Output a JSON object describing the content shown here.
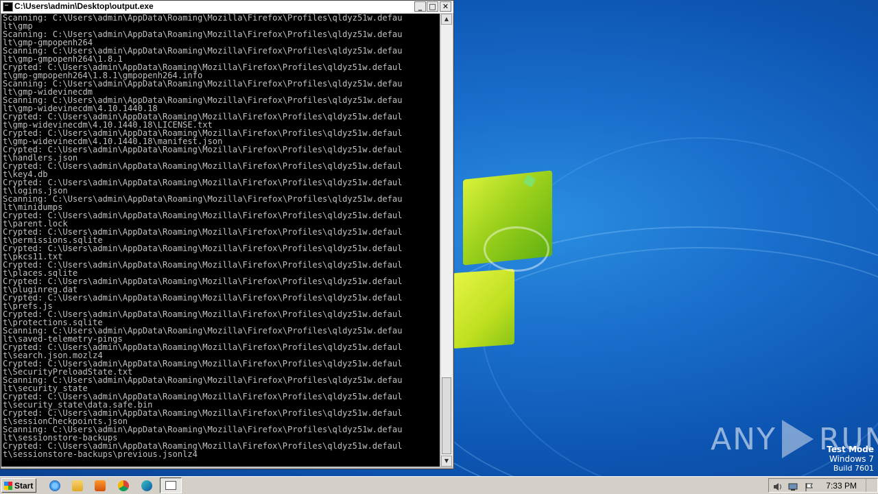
{
  "window": {
    "title": "C:\\Users\\admin\\Desktop\\output.exe",
    "buttons": {
      "minimize": "_",
      "maximize": "□",
      "close": "✕"
    },
    "console_lines": [
      "Scanning: C:\\Users\\admin\\AppData\\Roaming\\Mozilla\\Firefox\\Profiles\\qldyz51w.defau",
      "lt\\gmp",
      "Scanning: C:\\Users\\admin\\AppData\\Roaming\\Mozilla\\Firefox\\Profiles\\qldyz51w.defau",
      "lt\\gmp-gmpopenh264",
      "Scanning: C:\\Users\\admin\\AppData\\Roaming\\Mozilla\\Firefox\\Profiles\\qldyz51w.defau",
      "lt\\gmp-gmpopenh264\\1.8.1",
      "Crypted: C:\\Users\\admin\\AppData\\Roaming\\Mozilla\\Firefox\\Profiles\\qldyz51w.defaul",
      "t\\gmp-gmpopenh264\\1.8.1\\gmpopenh264.info",
      "Scanning: C:\\Users\\admin\\AppData\\Roaming\\Mozilla\\Firefox\\Profiles\\qldyz51w.defau",
      "lt\\gmp-widevinecdm",
      "Scanning: C:\\Users\\admin\\AppData\\Roaming\\Mozilla\\Firefox\\Profiles\\qldyz51w.defau",
      "lt\\gmp-widevinecdm\\4.10.1440.18",
      "Crypted: C:\\Users\\admin\\AppData\\Roaming\\Mozilla\\Firefox\\Profiles\\qldyz51w.defaul",
      "t\\gmp-widevinecdm\\4.10.1440.18\\LICENSE.txt",
      "Crypted: C:\\Users\\admin\\AppData\\Roaming\\Mozilla\\Firefox\\Profiles\\qldyz51w.defaul",
      "t\\gmp-widevinecdm\\4.10.1440.18\\manifest.json",
      "Crypted: C:\\Users\\admin\\AppData\\Roaming\\Mozilla\\Firefox\\Profiles\\qldyz51w.defaul",
      "t\\handlers.json",
      "Crypted: C:\\Users\\admin\\AppData\\Roaming\\Mozilla\\Firefox\\Profiles\\qldyz51w.defaul",
      "t\\key4.db",
      "Crypted: C:\\Users\\admin\\AppData\\Roaming\\Mozilla\\Firefox\\Profiles\\qldyz51w.defaul",
      "t\\logins.json",
      "Scanning: C:\\Users\\admin\\AppData\\Roaming\\Mozilla\\Firefox\\Profiles\\qldyz51w.defau",
      "lt\\minidumps",
      "Crypted: C:\\Users\\admin\\AppData\\Roaming\\Mozilla\\Firefox\\Profiles\\qldyz51w.defaul",
      "t\\parent.lock",
      "Crypted: C:\\Users\\admin\\AppData\\Roaming\\Mozilla\\Firefox\\Profiles\\qldyz51w.defaul",
      "t\\permissions.sqlite",
      "Crypted: C:\\Users\\admin\\AppData\\Roaming\\Mozilla\\Firefox\\Profiles\\qldyz51w.defaul",
      "t\\pkcs11.txt",
      "Crypted: C:\\Users\\admin\\AppData\\Roaming\\Mozilla\\Firefox\\Profiles\\qldyz51w.defaul",
      "t\\places.sqlite",
      "Crypted: C:\\Users\\admin\\AppData\\Roaming\\Mozilla\\Firefox\\Profiles\\qldyz51w.defaul",
      "t\\pluginreg.dat",
      "Crypted: C:\\Users\\admin\\AppData\\Roaming\\Mozilla\\Firefox\\Profiles\\qldyz51w.defaul",
      "t\\prefs.js",
      "Crypted: C:\\Users\\admin\\AppData\\Roaming\\Mozilla\\Firefox\\Profiles\\qldyz51w.defaul",
      "t\\protections.sqlite",
      "Scanning: C:\\Users\\admin\\AppData\\Roaming\\Mozilla\\Firefox\\Profiles\\qldyz51w.defau",
      "lt\\saved-telemetry-pings",
      "Crypted: C:\\Users\\admin\\AppData\\Roaming\\Mozilla\\Firefox\\Profiles\\qldyz51w.defaul",
      "t\\search.json.mozlz4",
      "Crypted: C:\\Users\\admin\\AppData\\Roaming\\Mozilla\\Firefox\\Profiles\\qldyz51w.defaul",
      "t\\SecurityPreloadState.txt",
      "Scanning: C:\\Users\\admin\\AppData\\Roaming\\Mozilla\\Firefox\\Profiles\\qldyz51w.defau",
      "lt\\security_state",
      "Crypted: C:\\Users\\admin\\AppData\\Roaming\\Mozilla\\Firefox\\Profiles\\qldyz51w.defaul",
      "t\\security_state\\data.safe.bin",
      "Crypted: C:\\Users\\admin\\AppData\\Roaming\\Mozilla\\Firefox\\Profiles\\qldyz51w.defaul",
      "t\\sessionCheckpoints.json",
      "Scanning: C:\\Users\\admin\\AppData\\Roaming\\Mozilla\\Firefox\\Profiles\\qldyz51w.defau",
      "lt\\sessionstore-backups",
      "Crypted: C:\\Users\\admin\\AppData\\Roaming\\Mozilla\\Firefox\\Profiles\\qldyz51w.defaul",
      "t\\sessionstore-backups\\previous.jsonlz4"
    ]
  },
  "desktop": {
    "watermark_left": "ANY",
    "watermark_right": "RUN",
    "test_mode": "Test Mode",
    "os_name": "Windows 7",
    "build": "Build 7601"
  },
  "taskbar": {
    "start_label": "Start",
    "clock": "7:33 PM",
    "quick_launch": [
      "ie-icon",
      "explorer-folder-icon",
      "media-player-icon",
      "chrome-icon",
      "edge-icon"
    ]
  },
  "colors": {
    "console_bg": "#000000",
    "console_text": "#c0c0c0",
    "desktop_blue": "#1a6fcc",
    "taskbar": "#d4d0c8"
  }
}
